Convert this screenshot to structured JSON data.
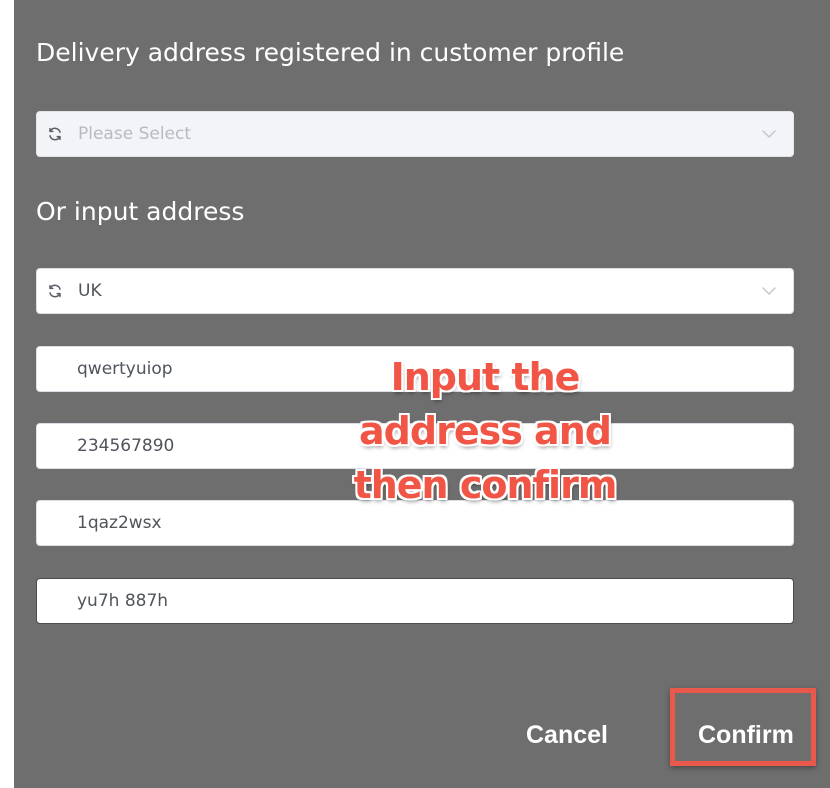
{
  "dialog": {
    "registered_heading": "Delivery address registered in customer profile",
    "registered_select": {
      "placeholder": "Please Select",
      "icon": "refresh-icon",
      "chevron_icon": "chevron-down-icon",
      "disabled": true
    },
    "input_heading": "Or input address",
    "country_select": {
      "value": "UK",
      "icon": "refresh-icon",
      "chevron_icon": "chevron-down-icon"
    },
    "address_fields": [
      {
        "value": "qwertyuiop"
      },
      {
        "value": "234567890"
      },
      {
        "value": "1qaz2wsx"
      },
      {
        "value": "yu7h 887h"
      }
    ],
    "buttons": {
      "cancel": "Cancel",
      "confirm": "Confirm"
    }
  },
  "annotation": {
    "lines": [
      "Input the",
      "address and",
      "then confirm"
    ],
    "color": "#f05545"
  },
  "colors": {
    "panel_bg": "#6e6e6e",
    "highlight": "#e8594b"
  }
}
